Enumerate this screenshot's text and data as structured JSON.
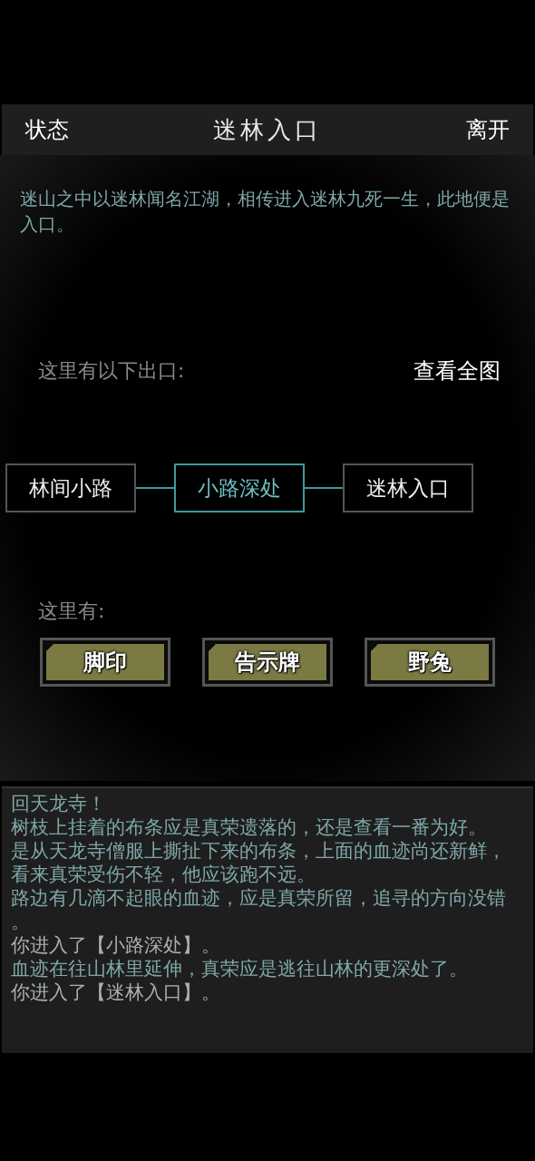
{
  "header": {
    "left_button": "状态",
    "title": "迷林入口",
    "right_button": "离开"
  },
  "description": "迷山之中以迷林闻名江湖，相传进入迷林九死一生，此地便是入口。",
  "exits": {
    "label": "这里有以下出口:",
    "map_button": "查看全图",
    "nodes": [
      {
        "label": "林间小路",
        "selected": false
      },
      {
        "label": "小路深处",
        "selected": true
      },
      {
        "label": "迷林入口",
        "selected": false
      }
    ]
  },
  "items": {
    "label": "这里有:",
    "buttons": [
      "脚印",
      "告示牌",
      "野兔"
    ]
  },
  "log": [
    {
      "kind": "narration",
      "text": "回天龙寺！"
    },
    {
      "kind": "narration",
      "text": "树枝上挂着的布条应是真荣遗落的，还是查看一番为好。"
    },
    {
      "kind": "narration",
      "text": "是从天龙寺僧服上撕扯下来的布条，上面的血迹尚还新鲜，看来真荣受伤不轻，他应该跑不远。"
    },
    {
      "kind": "narration",
      "text": "路边有几滴不起眼的血迹，应是真荣所留，追寻的方向没错。"
    },
    {
      "kind": "system",
      "text": "你进入了【小路深处】。"
    },
    {
      "kind": "narration",
      "text": "血迹在往山林里延伸，真荣应是逃往山林的更深处了。"
    },
    {
      "kind": "system",
      "text": "你进入了【迷林入口】。"
    }
  ]
}
